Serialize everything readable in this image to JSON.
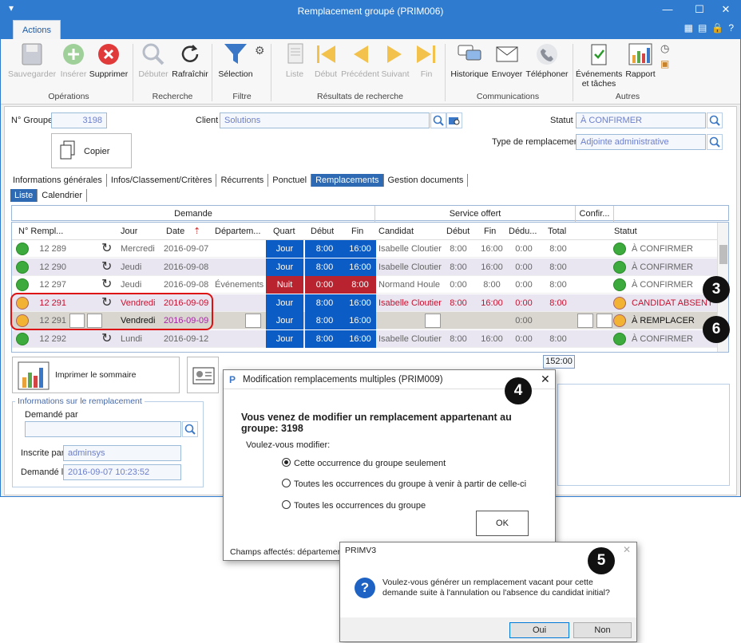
{
  "window": {
    "title": "Remplacement groupé (PRIM006)"
  },
  "ribbon": {
    "tab": "Actions",
    "buttons": {
      "save": "Sauvegarder",
      "insert": "Insérer",
      "delete": "Supprimer",
      "start": "Débuter",
      "refresh": "Rafraîchir",
      "selection": "Sélection",
      "list": "Liste",
      "first": "Début",
      "prev": "Précédent",
      "next": "Suivant",
      "last": "Fin",
      "history": "Historique",
      "send": "Envoyer",
      "phone": "Téléphoner",
      "events": "Événements et tâches",
      "report": "Rapport"
    },
    "groups": {
      "ops": "Opérations",
      "search": "Recherche",
      "filter": "Filtre",
      "results": "Résultats de recherche",
      "comms": "Communications",
      "other": "Autres"
    }
  },
  "form": {
    "group_label": "N° Groupe",
    "group_value": "3198",
    "client_label": "Client",
    "client_value": "Solutions",
    "status_label": "Statut",
    "status_value": "À CONFIRMER",
    "type_label": "Type de remplacement",
    "type_value": "Adjointe administrative",
    "copy_btn": "Copier"
  },
  "tabs": [
    "Informations générales",
    "Infos/Classement/Critères",
    "Récurrents",
    "Ponctuel",
    "Remplacements",
    "Gestion documents"
  ],
  "subtabs": [
    "Liste",
    "Calendrier"
  ],
  "grid": {
    "sections": {
      "demande": "Demande",
      "service": "Service offert",
      "confir": "Confir..."
    },
    "columns": {
      "num": "N° Rempl...",
      "jour": "Jour",
      "date": "Date",
      "dept": "Départem...",
      "quart": "Quart",
      "debut": "Début",
      "fin": "Fin",
      "candidat": "Candidat",
      "sdebut": "Début",
      "sfin": "Fin",
      "deduc": "Dédu...",
      "total": "Total",
      "statut": "Statut"
    },
    "rows": [
      {
        "num": "12 289",
        "jour": "Mercredi",
        "date": "2016-09-07",
        "dept": "",
        "quart": "Jour",
        "debut": "8:00",
        "fin": "16:00",
        "candidat": "Isabelle Cloutier",
        "sdebut": "8:00",
        "sfin": "16:00",
        "deduc": "0:00",
        "total": "8:00",
        "statut": "À CONFIRMER"
      },
      {
        "num": "12 290",
        "jour": "Jeudi",
        "date": "2016-09-08",
        "dept": "",
        "quart": "Jour",
        "debut": "8:00",
        "fin": "16:00",
        "candidat": "Isabelle Cloutier",
        "sdebut": "8:00",
        "sfin": "16:00",
        "deduc": "0:00",
        "total": "8:00",
        "statut": "À CONFIRMER"
      },
      {
        "num": "12 297",
        "jour": "Jeudi",
        "date": "2016-09-08",
        "dept": "Événements",
        "quart": "Nuit",
        "debut": "0:00",
        "fin": "8:00",
        "candidat": "Normand Houle",
        "sdebut": "0:00",
        "sfin": "8:00",
        "deduc": "0:00",
        "total": "8:00",
        "statut": "À CONFIRMER"
      },
      {
        "num": "12 291",
        "jour": "Vendredi",
        "date": "2016-09-09",
        "dept": "",
        "quart": "Jour",
        "debut": "8:00",
        "fin": "16:00",
        "candidat": "Isabelle Cloutier",
        "sdebut": "8:00",
        "sfin": "16:00",
        "deduc": "0:00",
        "total": "8:00",
        "statut": "CANDIDAT ABSENT"
      },
      {
        "num": "12 291",
        "jour": "Vendredi",
        "date": "2016-09-09",
        "dept": "",
        "quart": "Jour",
        "debut": "8:00",
        "fin": "16:00",
        "candidat": "",
        "sdebut": "",
        "sfin": "",
        "deduc": "0:00",
        "total": "",
        "statut": "À REMPLACER"
      },
      {
        "num": "12 292",
        "jour": "Lundi",
        "date": "2016-09-12",
        "dept": "",
        "quart": "Jour",
        "debut": "8:00",
        "fin": "16:00",
        "candidat": "Isabelle Cloutier",
        "sdebut": "8:00",
        "sfin": "16:00",
        "deduc": "0:00",
        "total": "8:00",
        "statut": "À CONFIRMER"
      }
    ],
    "total_hours": "152:00"
  },
  "print_summary": "Imprimer le sommaire",
  "info": {
    "legend": "Informations sur le remplacement",
    "demande_par_label": "Demandé par",
    "demande_par_value": "",
    "inscrite_label": "Inscrite par",
    "inscrite_value": "adminsys",
    "demande_le_label": "Demandé le",
    "demande_le_value": "2016-09-07 10:23:52"
  },
  "dialog1": {
    "title": "Modification remplacements multiples (PRIM009)",
    "heading": "Vous venez de modifier un remplacement appartenant au groupe: 3198",
    "question": "Voulez-vous modifier:",
    "options": [
      "Cette occurrence du groupe seulement",
      "Toutes les occurrences du groupe à venir à partir de celle-ci",
      "Toutes les occurrences du groupe"
    ],
    "ok": "OK",
    "footer": "Champs affectés: département,"
  },
  "dialog2": {
    "title": "PRIMV3",
    "message": "Voulez-vous générer un remplacement vacant pour cette demande suite à l'annulation ou l'absence du candidat initial?",
    "yes": "Oui",
    "no": "Non"
  },
  "badges": [
    "3",
    "4",
    "5",
    "6"
  ]
}
